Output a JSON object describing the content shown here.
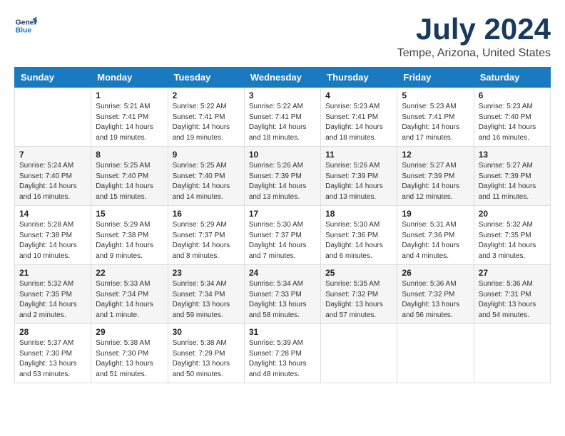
{
  "logo": {
    "line1": "General",
    "line2": "Blue"
  },
  "title": "July 2024",
  "location": "Tempe, Arizona, United States",
  "headers": [
    "Sunday",
    "Monday",
    "Tuesday",
    "Wednesday",
    "Thursday",
    "Friday",
    "Saturday"
  ],
  "weeks": [
    [
      {
        "day": "",
        "info": ""
      },
      {
        "day": "1",
        "info": "Sunrise: 5:21 AM\nSunset: 7:41 PM\nDaylight: 14 hours\nand 19 minutes."
      },
      {
        "day": "2",
        "info": "Sunrise: 5:22 AM\nSunset: 7:41 PM\nDaylight: 14 hours\nand 19 minutes."
      },
      {
        "day": "3",
        "info": "Sunrise: 5:22 AM\nSunset: 7:41 PM\nDaylight: 14 hours\nand 18 minutes."
      },
      {
        "day": "4",
        "info": "Sunrise: 5:23 AM\nSunset: 7:41 PM\nDaylight: 14 hours\nand 18 minutes."
      },
      {
        "day": "5",
        "info": "Sunrise: 5:23 AM\nSunset: 7:41 PM\nDaylight: 14 hours\nand 17 minutes."
      },
      {
        "day": "6",
        "info": "Sunrise: 5:23 AM\nSunset: 7:40 PM\nDaylight: 14 hours\nand 16 minutes."
      }
    ],
    [
      {
        "day": "7",
        "info": "Sunrise: 5:24 AM\nSunset: 7:40 PM\nDaylight: 14 hours\nand 16 minutes."
      },
      {
        "day": "8",
        "info": "Sunrise: 5:25 AM\nSunset: 7:40 PM\nDaylight: 14 hours\nand 15 minutes."
      },
      {
        "day": "9",
        "info": "Sunrise: 5:25 AM\nSunset: 7:40 PM\nDaylight: 14 hours\nand 14 minutes."
      },
      {
        "day": "10",
        "info": "Sunrise: 5:26 AM\nSunset: 7:39 PM\nDaylight: 14 hours\nand 13 minutes."
      },
      {
        "day": "11",
        "info": "Sunrise: 5:26 AM\nSunset: 7:39 PM\nDaylight: 14 hours\nand 13 minutes."
      },
      {
        "day": "12",
        "info": "Sunrise: 5:27 AM\nSunset: 7:39 PM\nDaylight: 14 hours\nand 12 minutes."
      },
      {
        "day": "13",
        "info": "Sunrise: 5:27 AM\nSunset: 7:39 PM\nDaylight: 14 hours\nand 11 minutes."
      }
    ],
    [
      {
        "day": "14",
        "info": "Sunrise: 5:28 AM\nSunset: 7:38 PM\nDaylight: 14 hours\nand 10 minutes."
      },
      {
        "day": "15",
        "info": "Sunrise: 5:29 AM\nSunset: 7:38 PM\nDaylight: 14 hours\nand 9 minutes."
      },
      {
        "day": "16",
        "info": "Sunrise: 5:29 AM\nSunset: 7:37 PM\nDaylight: 14 hours\nand 8 minutes."
      },
      {
        "day": "17",
        "info": "Sunrise: 5:30 AM\nSunset: 7:37 PM\nDaylight: 14 hours\nand 7 minutes."
      },
      {
        "day": "18",
        "info": "Sunrise: 5:30 AM\nSunset: 7:36 PM\nDaylight: 14 hours\nand 6 minutes."
      },
      {
        "day": "19",
        "info": "Sunrise: 5:31 AM\nSunset: 7:36 PM\nDaylight: 14 hours\nand 4 minutes."
      },
      {
        "day": "20",
        "info": "Sunrise: 5:32 AM\nSunset: 7:35 PM\nDaylight: 14 hours\nand 3 minutes."
      }
    ],
    [
      {
        "day": "21",
        "info": "Sunrise: 5:32 AM\nSunset: 7:35 PM\nDaylight: 14 hours\nand 2 minutes."
      },
      {
        "day": "22",
        "info": "Sunrise: 5:33 AM\nSunset: 7:34 PM\nDaylight: 14 hours\nand 1 minute."
      },
      {
        "day": "23",
        "info": "Sunrise: 5:34 AM\nSunset: 7:34 PM\nDaylight: 13 hours\nand 59 minutes."
      },
      {
        "day": "24",
        "info": "Sunrise: 5:34 AM\nSunset: 7:33 PM\nDaylight: 13 hours\nand 58 minutes."
      },
      {
        "day": "25",
        "info": "Sunrise: 5:35 AM\nSunset: 7:32 PM\nDaylight: 13 hours\nand 57 minutes."
      },
      {
        "day": "26",
        "info": "Sunrise: 5:36 AM\nSunset: 7:32 PM\nDaylight: 13 hours\nand 56 minutes."
      },
      {
        "day": "27",
        "info": "Sunrise: 5:36 AM\nSunset: 7:31 PM\nDaylight: 13 hours\nand 54 minutes."
      }
    ],
    [
      {
        "day": "28",
        "info": "Sunrise: 5:37 AM\nSunset: 7:30 PM\nDaylight: 13 hours\nand 53 minutes."
      },
      {
        "day": "29",
        "info": "Sunrise: 5:38 AM\nSunset: 7:30 PM\nDaylight: 13 hours\nand 51 minutes."
      },
      {
        "day": "30",
        "info": "Sunrise: 5:38 AM\nSunset: 7:29 PM\nDaylight: 13 hours\nand 50 minutes."
      },
      {
        "day": "31",
        "info": "Sunrise: 5:39 AM\nSunset: 7:28 PM\nDaylight: 13 hours\nand 48 minutes."
      },
      {
        "day": "",
        "info": ""
      },
      {
        "day": "",
        "info": ""
      },
      {
        "day": "",
        "info": ""
      }
    ]
  ]
}
